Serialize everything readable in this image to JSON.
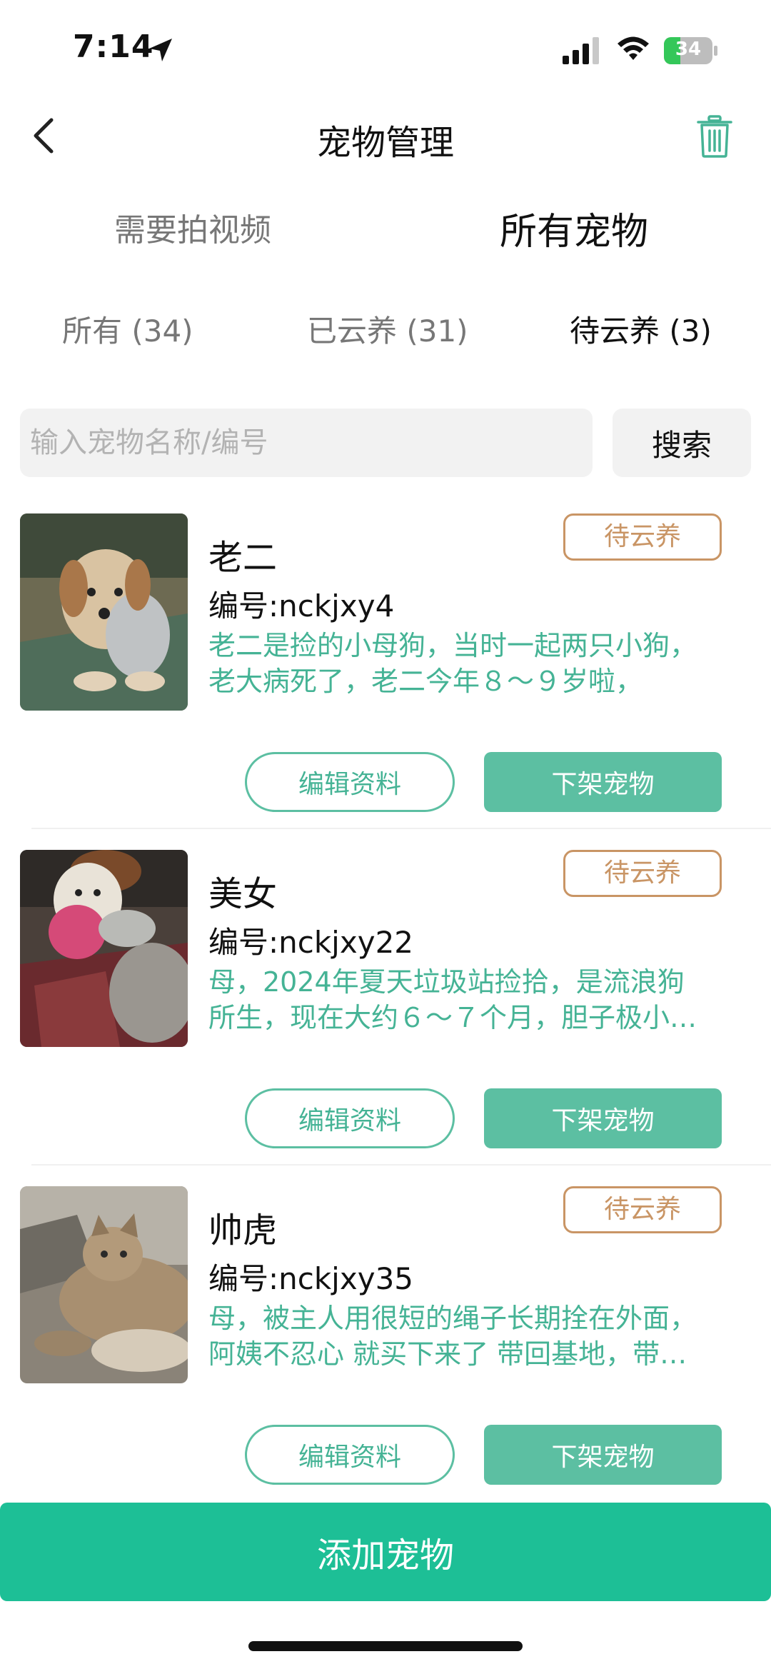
{
  "status_bar": {
    "time": "7:14",
    "battery": "34",
    "battery_level": 0.34
  },
  "nav": {
    "title": "宠物管理"
  },
  "main_tabs": [
    {
      "label": "需要拍视频",
      "active": false
    },
    {
      "label": "所有宠物",
      "active": true
    }
  ],
  "sub_tabs": [
    {
      "label": "所有 (34)",
      "active": false
    },
    {
      "label": "已云养 (31)",
      "active": false
    },
    {
      "label": "待云养 (3)",
      "active": true
    }
  ],
  "search": {
    "placeholder": "输入宠物名称/编号",
    "button": "搜索"
  },
  "pets": [
    {
      "name": "老二",
      "id": "编号:nckjxy4",
      "desc_lines": [
        "老二是捡的小母狗，当时一起两只小狗，",
        "老大病死了，老二今年８～９岁啦，"
      ],
      "status": "待云养",
      "edit": "编辑资料",
      "offline": "下架宠物"
    },
    {
      "name": "美女",
      "id": "编号:nckjxy22",
      "desc_lines": [
        "母，2024年夏天垃圾站捡拾，是流浪狗",
        "所生，现在大约６～７个月，胆子极小…"
      ],
      "status": "待云养",
      "edit": "编辑资料",
      "offline": "下架宠物"
    },
    {
      "name": "帅虎",
      "id": "编号:nckjxy35",
      "desc_lines": [
        "母，被主人用很短的绳子长期拴在外面，",
        "阿姨不忍心 就买下来了 带回基地，带…"
      ],
      "status": "待云养",
      "edit": "编辑资料",
      "offline": "下架宠物"
    }
  ],
  "add_button": "添加宠物",
  "colors": {
    "accent": "#1dbf96",
    "button_green": "#5cbfa2",
    "badge": "#c99565",
    "desc": "#45b395"
  }
}
